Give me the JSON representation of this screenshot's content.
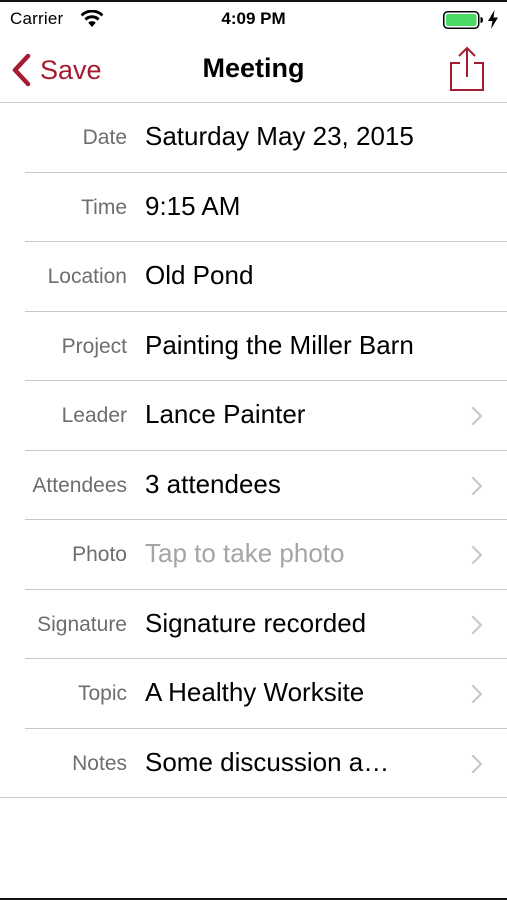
{
  "status_bar": {
    "carrier": "Carrier",
    "time": "4:09 PM",
    "icons": [
      "wifi-icon",
      "battery-icon",
      "charging-bolt-icon"
    ],
    "battery_color": "#4cd964"
  },
  "nav_bar": {
    "back_label": "Save",
    "title": "Meeting",
    "back_icon": "chevron-left-icon",
    "action_icon": "share-icon",
    "accent_color": "#a51c30"
  },
  "form": {
    "rows": [
      {
        "label": "Date",
        "value": "Saturday May 23, 2015",
        "disclosure": false,
        "placeholder": false
      },
      {
        "label": "Time",
        "value": "9:15 AM",
        "disclosure": false,
        "placeholder": false
      },
      {
        "label": "Location",
        "value": "Old Pond",
        "disclosure": false,
        "placeholder": false
      },
      {
        "label": "Project",
        "value": "Painting the Miller Barn",
        "disclosure": false,
        "placeholder": false
      },
      {
        "label": "Leader",
        "value": "Lance Painter",
        "disclosure": true,
        "placeholder": false
      },
      {
        "label": "Attendees",
        "value": "3 attendees",
        "disclosure": true,
        "placeholder": false
      },
      {
        "label": "Photo",
        "value": "Tap to take photo",
        "disclosure": true,
        "placeholder": true
      },
      {
        "label": "Signature",
        "value": "Signature recorded",
        "disclosure": true,
        "placeholder": false
      },
      {
        "label": "Topic",
        "value": "A Healthy Worksite",
        "disclosure": true,
        "placeholder": false
      },
      {
        "label": "Notes",
        "value": "Some discussion a…",
        "disclosure": true,
        "placeholder": false
      }
    ]
  }
}
